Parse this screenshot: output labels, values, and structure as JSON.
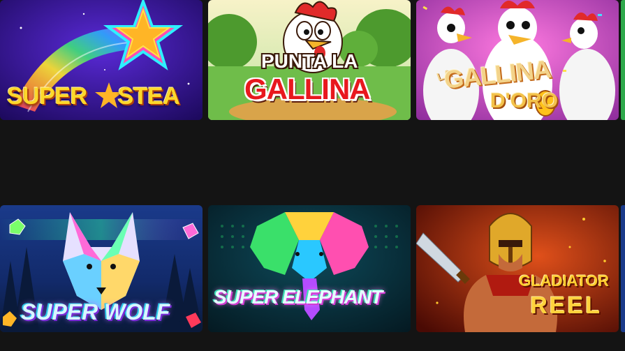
{
  "games": [
    {
      "id": "super-stea",
      "title": "SUPER",
      "title2": "STEA",
      "tm": "™"
    },
    {
      "id": "punta-la-gallina",
      "title_top": "PUNTA LA",
      "title_main": "GALLINA",
      "tm": "™"
    },
    {
      "id": "gallina-doro",
      "title_la": "LA",
      "title_main": "GALLINA",
      "title_sub": "D'ORO",
      "tm": "™"
    },
    {
      "id": "super-wolf",
      "title": "SUPER WOLF",
      "tm": "™"
    },
    {
      "id": "super-elephant",
      "title": "SUPER ELEPHANT",
      "tm": "™"
    },
    {
      "id": "gladiator-reel",
      "title_top": "GLADIATOR",
      "title_main": "REEL"
    }
  ],
  "colors": {
    "page_background": "#141414",
    "super_stea_bg": "#2a0e7a",
    "punta_gallina_bg": "#6fbd4a",
    "gallina_doro_bg": "#c14bbd",
    "super_wolf_bg": "#0b1b4a",
    "super_elephant_bg": "#06283a",
    "gladiator_reel_bg": "#7a1a08",
    "right_edge_peek": "#2ea84b"
  }
}
